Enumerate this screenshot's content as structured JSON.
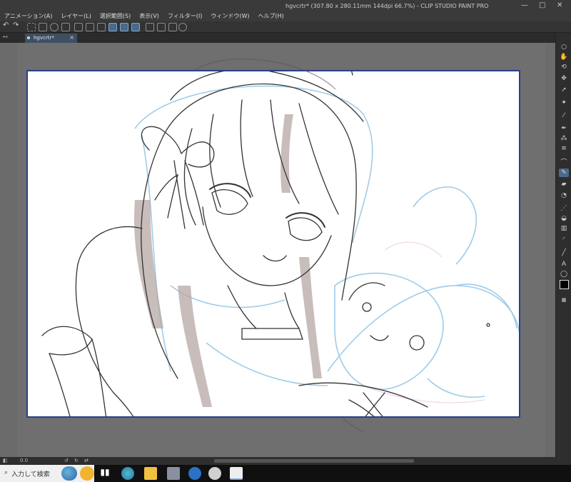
{
  "window": {
    "title": "hgvcrtr* (307.80 x 280.11mm 144dpi 66.7%) - CLIP STUDIO PAINT PRO",
    "min_glyph": "—",
    "max_glyph": "□",
    "close_glyph": "✕"
  },
  "menu": [
    "アニメーション(A)",
    "レイヤー(L)",
    "選択範囲(S)",
    "表示(V)",
    "フィルター(I)",
    "ウィンドウ(W)",
    "ヘルプ(H)"
  ],
  "tabs": [
    {
      "label": "hgvcrtr*",
      "close": "×"
    }
  ],
  "statusbar": {
    "zoom": "0.0"
  },
  "taskbar": {
    "search_placeholder": "入力して検索",
    "search_icon": "search-icon"
  },
  "toolbar": {
    "selected_tool": "pencil-icon",
    "main_color": "#000000"
  },
  "colors": {
    "canvas_border": "#2b3f8a",
    "workspace": "#6b6b6b",
    "ui_dark": "#2e2e2e",
    "sketch_line": "#333333",
    "sketch_blue": "#8fc3e6",
    "hair_shadow": "#b5a7a4"
  }
}
